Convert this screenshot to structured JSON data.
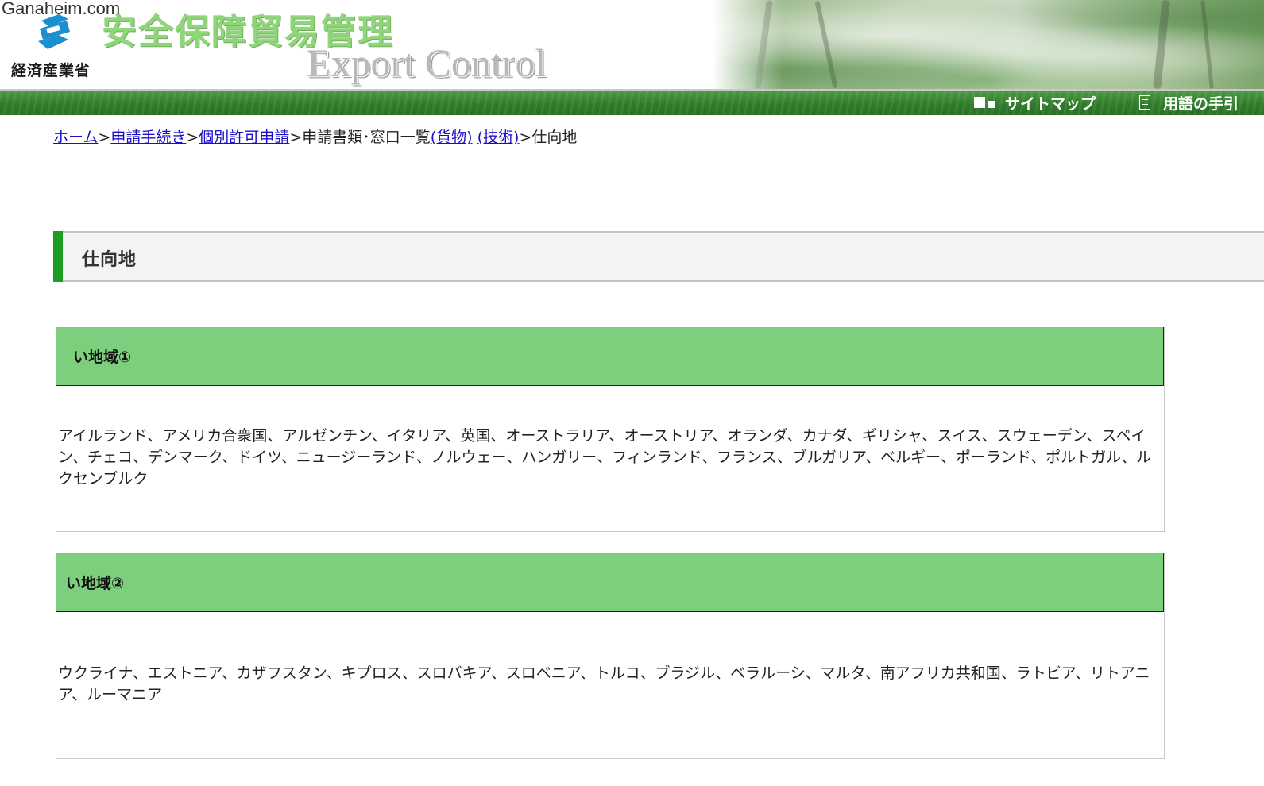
{
  "watermark": "Ganaheim.com",
  "header": {
    "ministry": "経済産業省",
    "title_jp": "安全保障貿易管理",
    "title_en": "Export Control",
    "nav": {
      "sitemap": "サイトマップ",
      "glossary": "用語の手引"
    }
  },
  "breadcrumb": {
    "home": "ホーム",
    "sep": ">",
    "procedures": "申請手続き",
    "individual": "個別許可申請",
    "documents": "申請書類･窓口一覧",
    "goods": "(貨物)",
    "tech": "(技術)",
    "current": "仕向地"
  },
  "page_title": "仕向地",
  "regions": [
    {
      "heading": "い地域①",
      "countries": "アイルランド、アメリカ合衆国、アルゼンチン、イタリア、英国、オーストラリア、オーストリア、オランダ、カナダ、ギリシャ、スイス、スウェーデン、スペイン、チェコ、デンマーク、ドイツ、ニュージーランド、ノルウェー、ハンガリー、フィンランド、フランス、ブルガリア、ベルギー、ポーランド、ポルトガル、ルクセンブルク"
    },
    {
      "heading": "い地域②",
      "countries": "ウクライナ、エストニア、カザフスタン、キプロス、スロバキア、スロベニア、トルコ、ブラジル、ベラルーシ、マルタ、南アフリカ共和国、ラトビア、リトアニア、ルーマニア"
    }
  ],
  "colors": {
    "accent_green": "#1f9d23",
    "region_header": "#7dce7d",
    "link": "#1a0dcc"
  }
}
